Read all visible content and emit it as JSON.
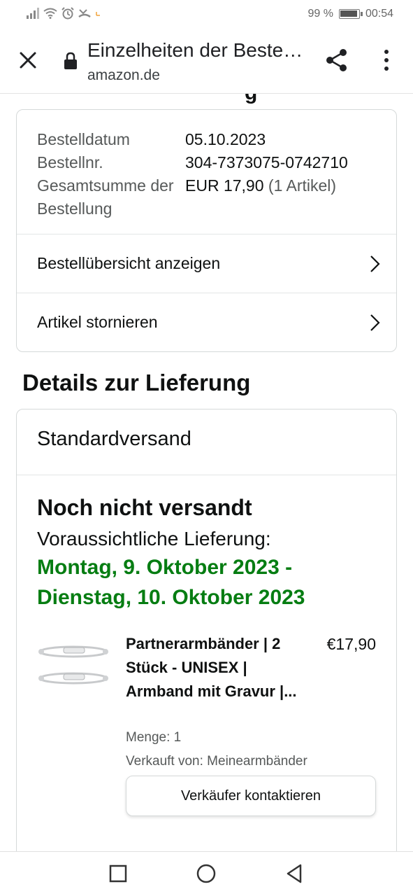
{
  "status_bar": {
    "battery": "99 %",
    "time": "00:54"
  },
  "browser": {
    "title": "Einzelheiten der Bestellung",
    "url": "amazon.de"
  },
  "order_summary": {
    "rows": [
      {
        "label": "Bestelldatum",
        "value": "05.10.2023",
        "extra": ""
      },
      {
        "label": "Bestellnr.",
        "value": "304-7373075-0742710",
        "extra": ""
      },
      {
        "label": "Gesamtsumme der Bestellung",
        "value": "EUR 17,90",
        "extra": " (1 Artikel)"
      }
    ],
    "links": [
      {
        "label": "Bestellübersicht anzeigen"
      },
      {
        "label": "Artikel stornieren"
      }
    ]
  },
  "delivery": {
    "section_title": "Details zur Lieferung",
    "shipping_method": "Standardversand",
    "status": "Noch nicht versandt",
    "expected_label": "Voraussichtliche Lieferung:",
    "date_range_line1": "Montag, 9. Oktober 2023 -",
    "date_range_line2": "Dienstag, 10. Oktober 2023",
    "date_color": "#067d12",
    "item": {
      "title": "Partnerarmbänder | 2 Stück - UNISEX | Armband mit Gravur |...",
      "price": "€17,90",
      "quantity": "Menge: 1",
      "seller": "Verkauft von: Meinearmbänder",
      "contact_button": "Verkäufer kontaktieren"
    }
  },
  "icons": {
    "close": "close-icon",
    "lock": "lock-icon",
    "share": "share-icon",
    "more": "more-vert-icon",
    "chevron": "chevron-right-icon",
    "nav_recent": "square-icon",
    "nav_home": "circle-icon",
    "nav_back": "triangle-back-icon"
  }
}
